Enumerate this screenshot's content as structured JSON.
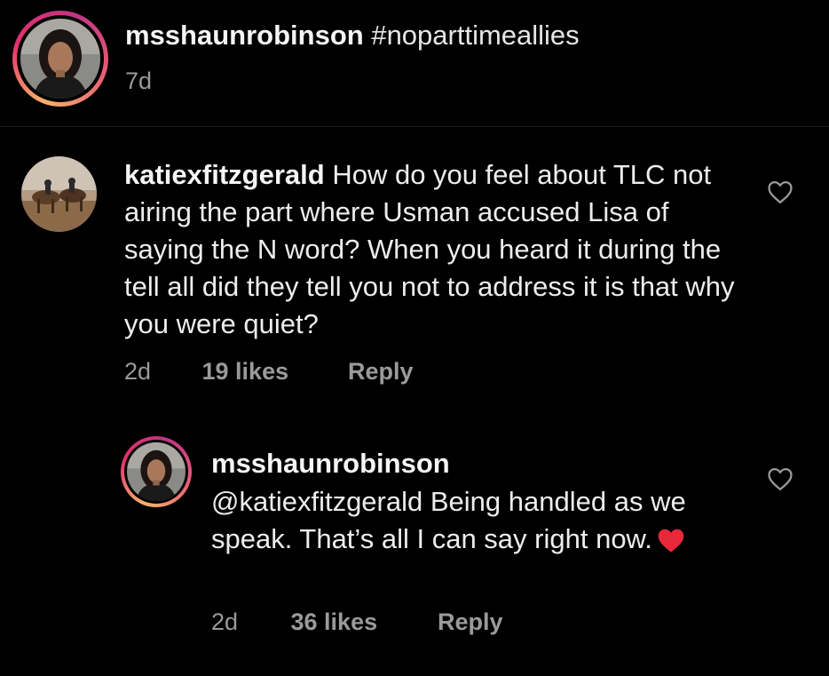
{
  "caption": {
    "username": "msshaunrobinson",
    "text": "#noparttimeallies",
    "time": "7d",
    "avatar_icon": "profile-photo-woman"
  },
  "comments": [
    {
      "username": "katiexfitzgerald",
      "text": "How do you feel about TLC not airing the part where Usman accused Lisa of saying the N word? When you heard it during the tell all did they tell you not to address it is that why you were quiet?",
      "time": "2d",
      "likes": "19 likes",
      "reply_label": "Reply",
      "like_icon": "heart-outline-icon",
      "avatar_icon": "profile-photo-camels-desert"
    }
  ],
  "reply": {
    "username": "msshaunrobinson",
    "mention": "@katiexfitzgerald",
    "text": "Being handled as we speak. That’s all I can say right now.",
    "emoji": "red-heart-emoji",
    "time": "2d",
    "likes": "36 likes",
    "reply_label": "Reply",
    "like_icon": "heart-outline-icon",
    "avatar_icon": "profile-photo-woman"
  },
  "colors": {
    "background": "#000000",
    "primary_text": "#f2f2f2",
    "secondary_text": "#9a9a9a",
    "heart_red": "#e8283a",
    "story_ring": "#e1306c"
  }
}
